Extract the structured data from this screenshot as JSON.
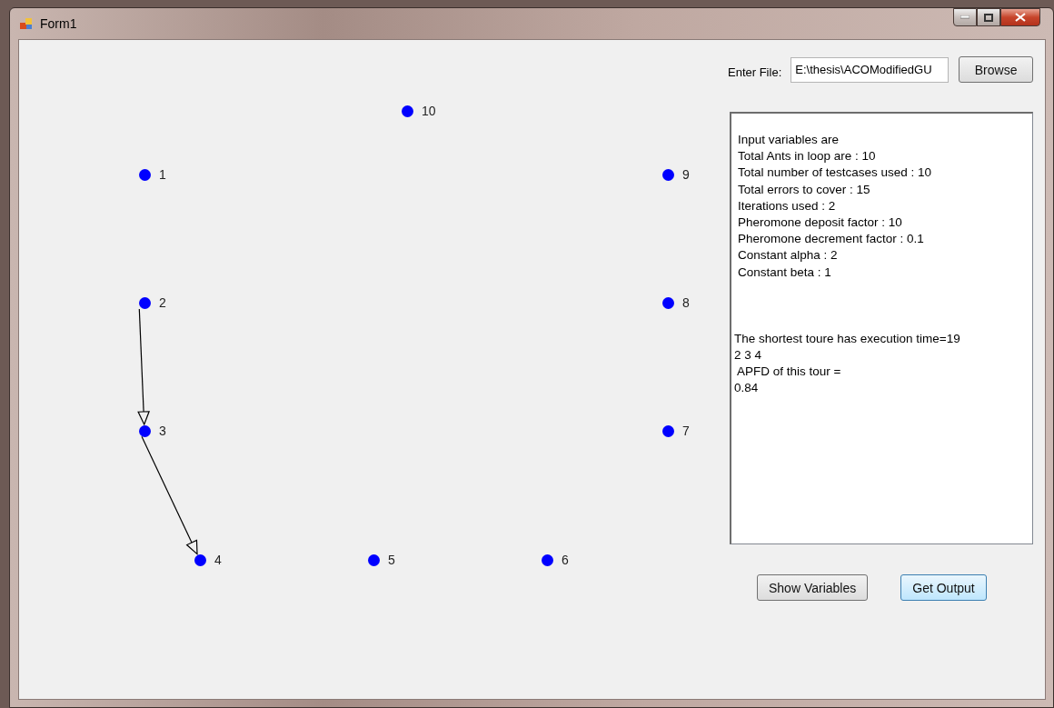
{
  "window": {
    "title": "Form1"
  },
  "graph": {
    "nodes": [
      {
        "label": "10",
        "in_tour": false
      },
      {
        "label": "1",
        "in_tour": false
      },
      {
        "label": "9",
        "in_tour": false
      },
      {
        "label": "2",
        "in_tour": true
      },
      {
        "label": "8",
        "in_tour": false
      },
      {
        "label": "3",
        "in_tour": true
      },
      {
        "label": "7",
        "in_tour": false
      },
      {
        "label": "4",
        "in_tour": true
      },
      {
        "label": "5",
        "in_tour": false
      },
      {
        "label": "6",
        "in_tour": false
      }
    ]
  },
  "file": {
    "label": "Enter File:",
    "value": "E:\\thesis\\ACOModifiedGU",
    "browse": "Browse"
  },
  "output": {
    "variables": [
      "Input variables are",
      "Total Ants in loop are : 10",
      "Total number of testcases used : 10",
      "Total errors to cover : 15",
      "Iterations used : 2",
      "Pheromone deposit factor : 10",
      "Pheromone decrement factor : 0.1",
      "Constant alpha : 2",
      "Constant beta : 1"
    ],
    "result": [
      "The shortest toure has execution time=19",
      "2 3 4",
      " APFD of this tour =",
      "0.84"
    ]
  },
  "buttons": [
    {
      "label": "Show Variables",
      "focused": false
    },
    {
      "label": "Get Output",
      "focused": true
    }
  ]
}
